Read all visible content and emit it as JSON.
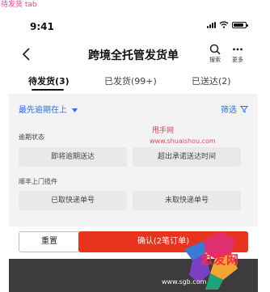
{
  "page_tag": "待发货 tab",
  "status": {
    "time": "9:41"
  },
  "nav": {
    "title": "跨境全托管发货单",
    "search_label": "搜索",
    "more_label": "更多"
  },
  "tabs": [
    {
      "label": "待发货(3)"
    },
    {
      "label": "已发货(99+)"
    },
    {
      "label": "已送达(2)"
    }
  ],
  "filter_bar": {
    "sort_label": "最先逾期在上",
    "filter_label": "筛选"
  },
  "sections": [
    {
      "label": "逾期状态",
      "options": [
        "即将逾期送达",
        "超出承诺送达时间"
      ]
    },
    {
      "label": "顺丰上门揽件",
      "options": [
        "已取快递单号",
        "未取快递单号"
      ]
    }
  ],
  "watermark": {
    "text": "甩手网",
    "url": "www.shuaishou.com"
  },
  "actions": {
    "reset_label": "重置",
    "confirm_label": "确认(2笔订单)"
  },
  "footer": {
    "logo_text": "思发网",
    "url": "www.sgb.com"
  },
  "colors": {
    "accent_blue": "#2b6df0",
    "confirm_red": "#e8341c",
    "tag_pink": "#ff3a8c"
  }
}
